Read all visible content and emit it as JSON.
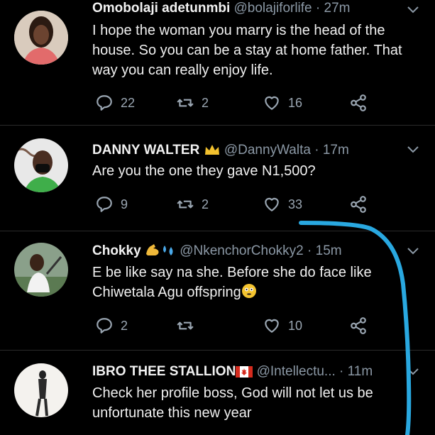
{
  "tweets": [
    {
      "name": "Omobolaji adetunmbi",
      "handle": "@bolajiforlife",
      "time": "· 27m",
      "text": "I hope the woman you marry is the head of the house. So you can be a stay at home father. That way you can really enjoy life.",
      "replies": "22",
      "retweets": "2",
      "likes": "16"
    },
    {
      "name": "DANNY WALTER",
      "handle": "@DannyWalta",
      "time": "· 17m",
      "text": "Are you the one they gave N1,500?",
      "replies": "9",
      "retweets": "2",
      "likes": "33"
    },
    {
      "name": "Chokky",
      "handle": "@NkenchorChokky2",
      "time": "· 15m",
      "text": "E be like say na she. Before she do face like Chiwetala Agu offspring",
      "replies": "2",
      "retweets": "",
      "likes": "10"
    },
    {
      "name": "IBRO THEE STALLION",
      "handle": "@Intellectu...",
      "time": "· 11m",
      "text": "Check her profile boss, God will not let us be unfortunate this new year",
      "replies": "",
      "retweets": "",
      "likes": ""
    }
  ],
  "colors": {
    "background": "#000000",
    "annotation": "#29a8e0",
    "muted": "#8b98a5"
  },
  "icons": [
    "reply-icon",
    "retweet-icon",
    "like-icon",
    "share-icon",
    "chevron-down-icon",
    "crown-icon",
    "flag-icon"
  ]
}
